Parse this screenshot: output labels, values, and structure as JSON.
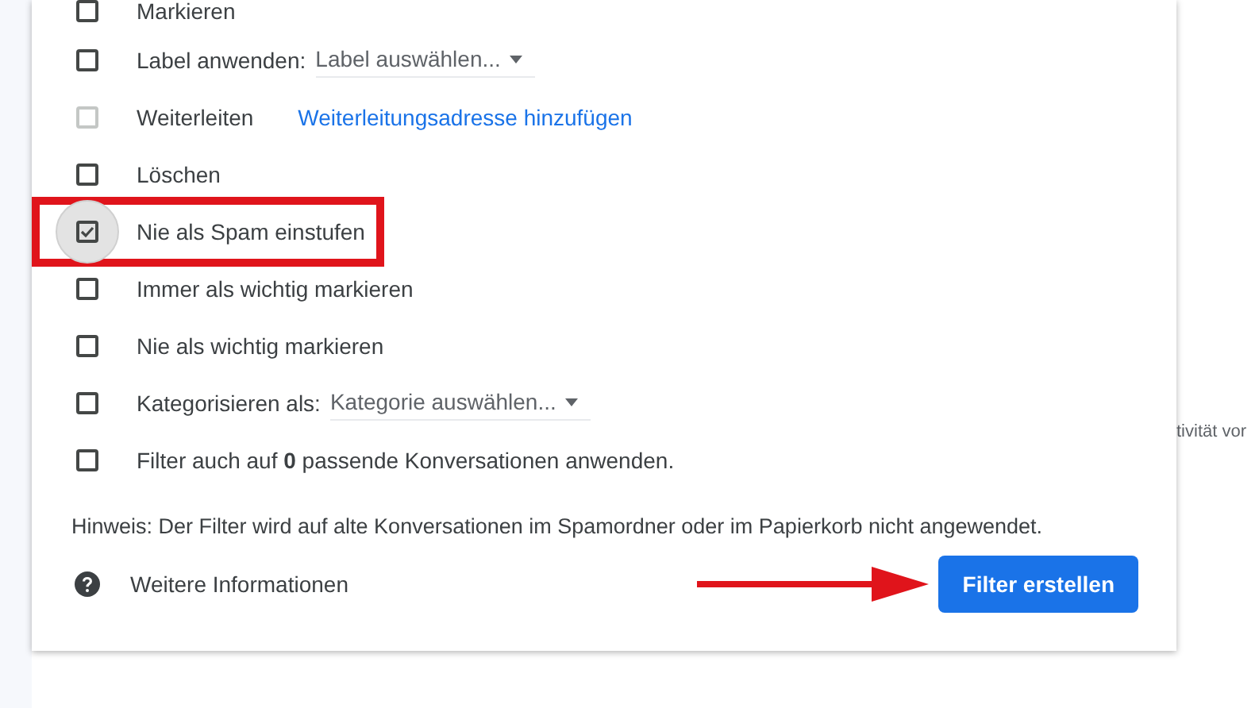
{
  "options": [
    {
      "kind": "plain",
      "label": "Markieren",
      "checked": false,
      "disabled": false,
      "highlighted": false
    },
    {
      "kind": "select",
      "label": "Label anwenden:",
      "select": "Label auswählen...",
      "checked": false,
      "disabled": false,
      "highlighted": false
    },
    {
      "kind": "link",
      "label": "Weiterleiten",
      "link": "Weiterleitungsadresse hinzufügen",
      "checked": false,
      "disabled": true,
      "highlighted": false
    },
    {
      "kind": "plain",
      "label": "Löschen",
      "checked": false,
      "disabled": false,
      "highlighted": false
    },
    {
      "kind": "plain",
      "label": "Nie als Spam einstufen",
      "checked": true,
      "disabled": false,
      "highlighted": true
    },
    {
      "kind": "plain",
      "label": "Immer als wichtig markieren",
      "checked": false,
      "disabled": false,
      "highlighted": false
    },
    {
      "kind": "plain",
      "label": "Nie als wichtig markieren",
      "checked": false,
      "disabled": false,
      "highlighted": false
    },
    {
      "kind": "select",
      "label": "Kategorisieren als:",
      "select": "Kategorie auswählen...",
      "checked": false,
      "disabled": false,
      "highlighted": false
    },
    {
      "kind": "plain",
      "label": "Filter auch auf **0** passende Konversationen anwenden.",
      "checked": false,
      "disabled": false,
      "highlighted": false
    }
  ],
  "note": "Hinweis: Der Filter wird auf alte Konversationen im Spamordner oder im Papierkorb nicht angewendet.",
  "help_link": "Weitere Informationen",
  "create_button": "Filter erstellen",
  "background_text": "tivität vor"
}
